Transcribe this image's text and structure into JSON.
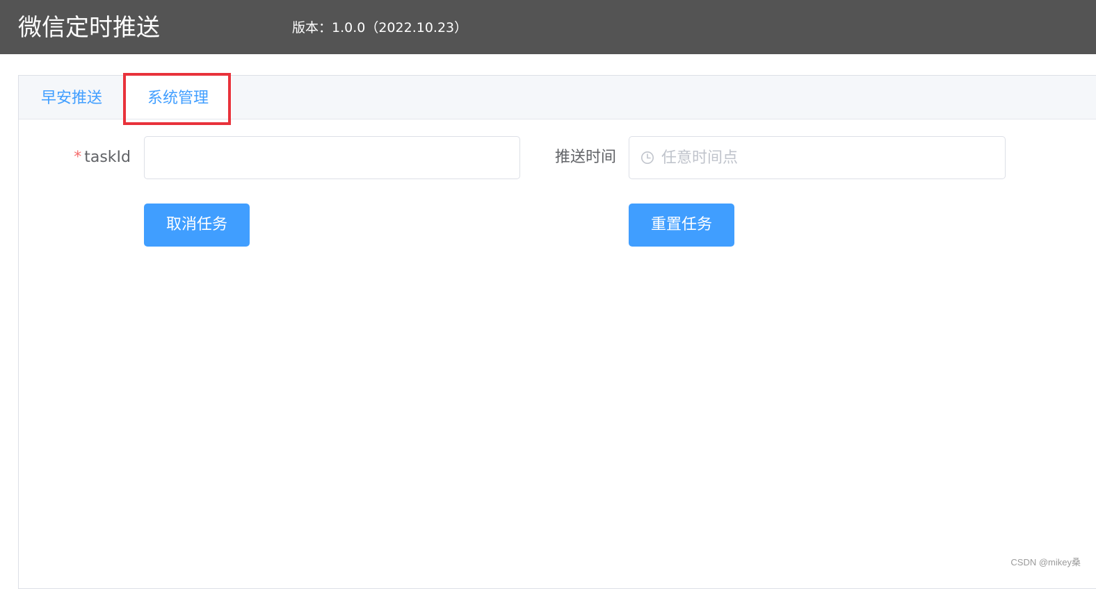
{
  "header": {
    "title": "微信定时推送",
    "version": "版本：1.0.0（2022.10.23）"
  },
  "tabs": [
    {
      "label": "早安推送",
      "active": false
    },
    {
      "label": "系统管理",
      "active": true
    }
  ],
  "form": {
    "task_id": {
      "required_mark": "*",
      "label": "taskId",
      "value": "",
      "placeholder": ""
    },
    "push_time": {
      "label": "推送时间",
      "value": "",
      "placeholder": "任意时间点",
      "icon": "clock-icon"
    }
  },
  "buttons": {
    "cancel_task": "取消任务",
    "reset_task": "重置任务"
  },
  "watermark": "CSDN @mikey桑",
  "colors": {
    "header_bg": "#545454",
    "accent": "#409eff",
    "highlight": "#e8323b",
    "required": "#f56c6c"
  }
}
